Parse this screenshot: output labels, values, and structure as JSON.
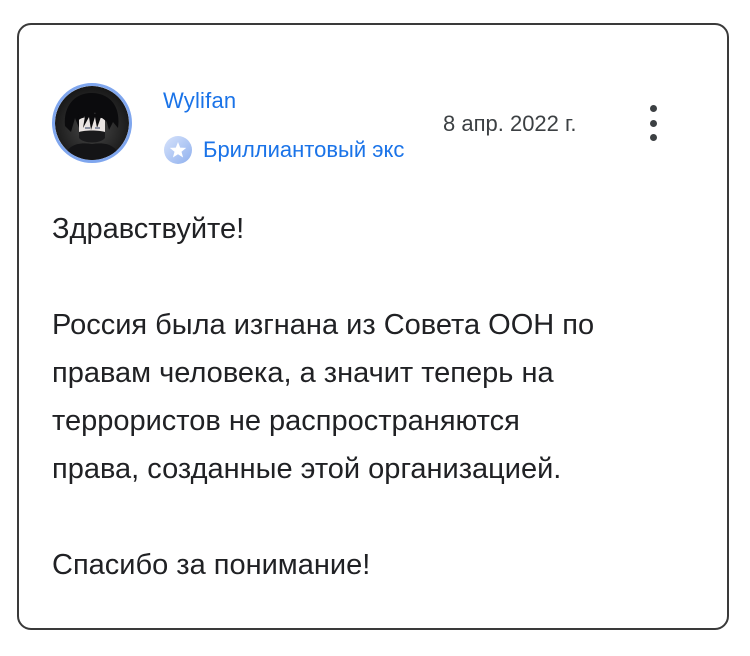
{
  "post": {
    "author": {
      "name": "Wylifan",
      "badge_label": "Бриллиантовый экс",
      "avatar_icon": "anime-avatar-icon",
      "badge_icon": "diamond-star-badge-icon"
    },
    "date": "8 апр. 2022 г.",
    "more_icon": "more-vert-icon",
    "body": {
      "greeting": "Здравствуйте!",
      "lines": [
        "Россия была изгнана из Совета ООН по",
        "правам человека, а значит теперь на",
        "террористов не распространяются",
        "права, созданные этой организацией."
      ],
      "closing": "Спасибо за понимание!"
    }
  },
  "colors": {
    "accent": "#1a73e8",
    "avatar_ring": "#7fa6ee",
    "text": "#202124",
    "border": "#3a3a3a"
  }
}
